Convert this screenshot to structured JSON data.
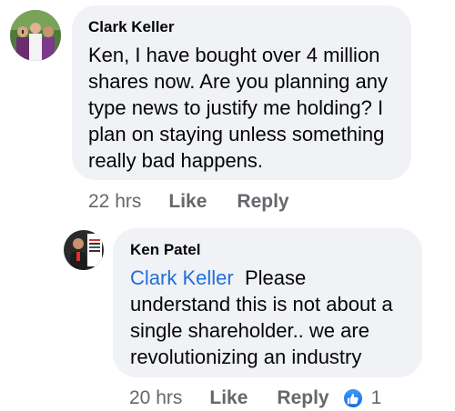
{
  "comment": {
    "author": "Clark Keller",
    "text": "Ken, I have bought over 4 million shares now. Are you planning any type news to justify me holding? I plan on staying unless something really bad happens.",
    "time": "22 hrs",
    "like_label": "Like",
    "reply_label": "Reply"
  },
  "reply": {
    "author": "Ken Patel",
    "mention": "Clark Keller",
    "text": "Please understand this is not about a single shareholder.. we are revolutionizing an industry",
    "time": "20 hrs",
    "like_label": "Like",
    "reply_label": "Reply",
    "reaction_count": "1",
    "reaction_icon": "thumbs-up-icon",
    "reaction_color": "#1877f2"
  },
  "colors": {
    "bubble": "#f0f2f5",
    "mention": "#216fdb",
    "meta": "#65676b",
    "text": "#050505"
  }
}
